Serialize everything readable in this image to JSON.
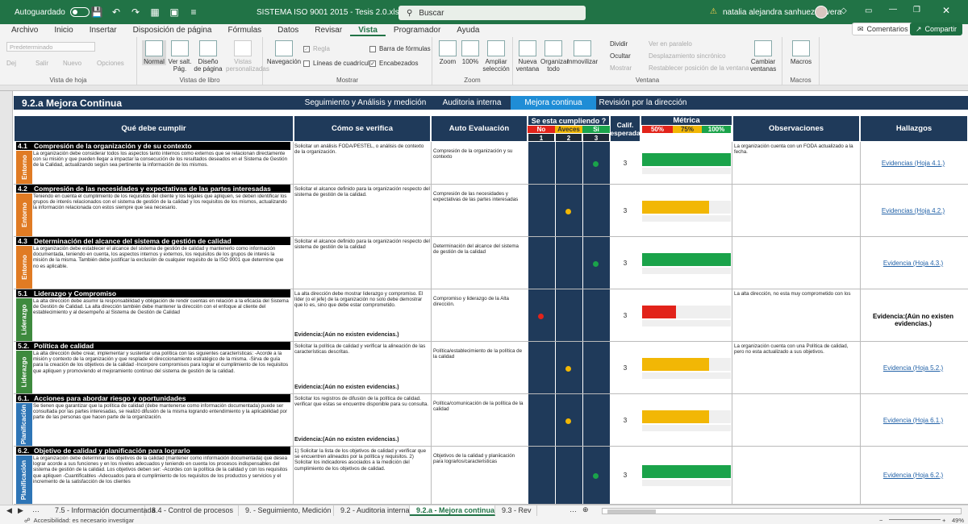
{
  "titlebar": {
    "autosave_label": "Autoguardado",
    "doc_title": "SISTEMA ISO 9001 2015 - Tesis 2.0.xlsm",
    "search_placeholder": "Buscar",
    "user_name": "natalia alejandra sanhueza rivera"
  },
  "menu": {
    "tabs": [
      "Archivo",
      "Inicio",
      "Insertar",
      "Disposición de página",
      "Fórmulas",
      "Datos",
      "Revisar",
      "Vista",
      "Programador",
      "Ayuda"
    ],
    "active": "Vista",
    "comments": "Comentarios",
    "share": "Compartir"
  },
  "ribbon": {
    "preset": "Predeterminado",
    "keep": "Dej",
    "exit": "Salir",
    "new": "Nuevo",
    "options": "Opciones",
    "g_sheet": "Vista de hoja",
    "normal": "Normal",
    "page_break": "Ver salt. Pág.",
    "page_layout": "Diseño de página",
    "custom_views": "Vistas personalizadas",
    "g_views": "Vistas de libro",
    "navigation": "Navegación",
    "ruler": "Regla",
    "gridlines": "Líneas de cuadrícula",
    "formula_bar": "Barra de fórmulas",
    "headings": "Encabezados",
    "g_show": "Mostrar",
    "zoom": "Zoom",
    "zoom100": "100%",
    "zoom_sel": "Ampliar selección",
    "g_zoom": "Zoom",
    "new_window": "Nueva ventana",
    "arrange": "Organizar todo",
    "freeze": "Inmovilizar",
    "split": "Dividir",
    "hide": "Ocultar",
    "unhide": "Mostrar",
    "side_by_side": "Ver en paralelo",
    "sync_scroll": "Desplazamiento sincrónico",
    "reset_pos": "Restablecer posición de la ventana",
    "switch": "Cambiar ventanas",
    "g_window": "Ventana",
    "macros": "Macros",
    "g_macros": "Macros"
  },
  "sheet": {
    "title": "9.2.a Mejora Continua",
    "nav": [
      "Seguimiento y Análisis y medición",
      "Auditoria interna",
      "Mejora continua",
      "Revisión por la dirección"
    ],
    "nav_active": "Mejora continua",
    "headers": {
      "req": "Qué debe cumplir",
      "verify": "Cómo se verifica",
      "self": "Auto Evaluación",
      "complying": "Se esta cumpliendo ?",
      "no": "No",
      "sometimes": "Aveces",
      "yes": "Si",
      "n1": "1",
      "n2": "2",
      "n3": "3",
      "calif": "Calif. esperada",
      "metric": "Métrica",
      "p50": "50%",
      "p75": "75%",
      "p100": "100%",
      "obs": "Observaciones",
      "findings": "Hallazgos"
    },
    "colors": {
      "red": "#e2231a",
      "amber": "#f2b705",
      "green": "#1aa34a",
      "navy": "#1f3a5a",
      "entorno": "#e07b24",
      "liderazgo": "#3e8a3e",
      "planif": "#2e75b6"
    },
    "rows": [
      {
        "no": "4.1",
        "title": "Compresión de la organización y de su contexto",
        "cat": "Entorno",
        "catcolor": "#e07b24",
        "text": "La organización debe considerar todos los aspectos tanto internos como externos que se relacionan directamente con su misión y que pueden llegar a impactar la consecución de los resultados deseados en el Sistema de Gestión de la Calidad, actualizando según sea pertinente la información de los mismos.",
        "verify": "Solicitar un análisis FODA/PESTEL, o análisis de contexto de la organización.",
        "evnote": "",
        "auto": "Compresión de la organización y su contexto",
        "level": 3,
        "calif": "3",
        "fill": 1.0,
        "fillcolor": "#1aa34a",
        "obs": "La organización cuenta con un FODA actualizado a la fecha.",
        "find": "Evidencias (Hoja 4.1.)",
        "findbold": false
      },
      {
        "no": "4.2",
        "title": "Compresión de las necesidades y expectativas de las partes interesadas",
        "cat": "Entorno",
        "catcolor": "#e07b24",
        "text": "Teniendo en cuenta el cumplimiento de los requisitos del cliente y los legales que apliquen, se deben identificar los grupos de interés relacionados con el sistema de gestión de la calidad y los requisitos de los mismos, actualizando la información relacionada con estos siempre que sea necesario.",
        "verify": "Solicitar el alcance definido para la organización respecto del sistema de gestión de la calidad.",
        "evnote": "",
        "auto": "Compresión de las necesidades y expectativas de las partes interesadas",
        "level": 2,
        "calif": "3",
        "fill": 0.75,
        "fillcolor": "#f2b705",
        "obs": "",
        "find": "Evidencias (Hoja 4.2.)",
        "findbold": false
      },
      {
        "no": "4.3",
        "title": "Determinación del alcance del sistema de gestión de calidad",
        "cat": "Entorno",
        "catcolor": "#e07b24",
        "text": "La organización debe establecer el alcance del sistema de gestión de calidad y mantenerlo como información documentada, teniendo en cuenta, los aspectos internos y externos, los requisitos de los grupos de interés la misión de la misma. También debe justificar la exclusión de cualquier requisito de la ISO 9001 que determine que no es aplicable.",
        "verify": "Solicitar el alcance definido para la organización respecto del sistema de gestión de la calidad",
        "evnote": "",
        "auto": "Determinación del alcance del sistema de gestión de la calidad",
        "level": 3,
        "calif": "3",
        "fill": 1.0,
        "fillcolor": "#1aa34a",
        "obs": "",
        "find": "Evidencia (Hoja 4.3.)",
        "findbold": false
      },
      {
        "no": "5.1",
        "title": "Liderazgo y Compromiso",
        "cat": "Liderazgo",
        "catcolor": "#3e8a3e",
        "text": "La alta dirección debe asumir la responsabilidad y obligación de rendir cuentas en relación a la eficacia del Sistema de Gestión de Calidad. La alta dirección también debe mantener la dirección con el enfoque al cliente del establecimiento y al desempeño al Sistema de Gestión de Calidad",
        "verify": "La alta dirección debe mostrar liderazgo y compromiso. El líder (o el jefe) de la organización no solo debe demostrar que lo es, sino que debe estar comprometido.",
        "evnote": "Evidencia:(Aún no existen evidencias.)",
        "auto": "Compromiso y liderazgo de la Alta dirección.",
        "level": 1,
        "calif": "3",
        "fill": 0.38,
        "fillcolor": "#e2231a",
        "obs": "La alta dirección, no esta muy comprometido con los",
        "find": "Evidencia:(Aún no existen evidencias.)",
        "findbold": true
      },
      {
        "no": "5.2.",
        "title": "Política de calidad",
        "cat": "Liderazgo",
        "catcolor": "#3e8a3e",
        "text": "La alta dirección debe crear, implementar y sustentar una política con las siguientes características: -Acorde a la misión y contexto de la organización y que resplade el direccionamiento estratégico de la misma. -Sirva de guía para la creación de los objetivos de la calidad -Incorpore compromisos para lograr el cumplimiento de los requisitos que apliquen y promoviendo el mejoramiento continuo del sistema de gestión de la calidad.",
        "verify": "Solicitar la política de calidad y verificar la alineación de las características descritas.",
        "evnote": "Evidencia:(Aún no existen evidencias.)",
        "auto": "Política/establecimiento de la política de la calidad",
        "level": 2,
        "calif": "3",
        "fill": 0.75,
        "fillcolor": "#f2b705",
        "obs": "La organización cuenta con una Política de calidad, pero no esta actualizado a sus objetivos.",
        "find": "Evidencia (Hoja 5.2.)",
        "findbold": false
      },
      {
        "no": "6.1.",
        "title": "Acciones para abordar riesgo y oportunidades",
        "cat": "Planificación",
        "catcolor": "#2e75b6",
        "text": "Se tienen que garantizar que la política de calidad (debe mantenerse como información documentada) puede ser consultada por las partes interesadas, se realizó difusión de la misma logrando entendimiento y la aplicabilidad por parte de las personas que hacen parte de la organización.",
        "verify": "Solicitar los registros de difusión de la política de calidad. verificar que estas se encuentre disponible para su consulta.",
        "evnote": "Evidencia:(Aún no existen evidencias.)",
        "auto": "Política/comunicación de la política de la calidad",
        "level": 2,
        "calif": "3",
        "fill": 0.75,
        "fillcolor": "#f2b705",
        "obs": "",
        "find": "Evidencia (Hoja 6.1.)",
        "findbold": false
      },
      {
        "no": "6.2.",
        "title": "Objetivo de calidad y planificación para lograrlo",
        "cat": "Planificación",
        "catcolor": "#2e75b6",
        "text": "La organización debe determinar los objetivos de la calidad (mantener como información documentada) que desea lograr acorde a sus funciones y en los niveles adecuados y teniendo en cuenta los procesos indispensables del sistema de gestión de la calidad. Los objetivos deben ser: -Acordes con la política de la calidad y con los requisitos que apliquen -Cuantificables -Adecuados para el cumplimiento de los requisitos de los productos y servicios y el incremento de la satisfacción de los clientes",
        "verify": "1) Solicitar la lista de los objetivos de calidad y verificar que se encuentren alineados por la política y requisitos. 2) Solicitar los indicadores asociados a la medición del cumplimiento de los objetivos de calidad.",
        "evnote": "",
        "auto": "Objetivos de la calidad y planiicación para lograrlos/caracteristicas",
        "level": 3,
        "calif": "3",
        "fill": 1.0,
        "fillcolor": "#1aa34a",
        "obs": "",
        "find": "Evidencia (Hoja 6.2.)",
        "findbold": false
      }
    ]
  },
  "tabs": [
    "7.5 - Información documentada",
    "8.4 - Control de procesos",
    "9. - Seguimiento, Medición",
    "9.2 - Auditoria interna",
    "9.2.a - Mejora continua",
    "9.3 - Rev"
  ],
  "active_tab": "9.2.a - Mejora continua",
  "status": {
    "accessibility": "Accesibilidad: es necesario investigar",
    "zoom": "49%"
  }
}
